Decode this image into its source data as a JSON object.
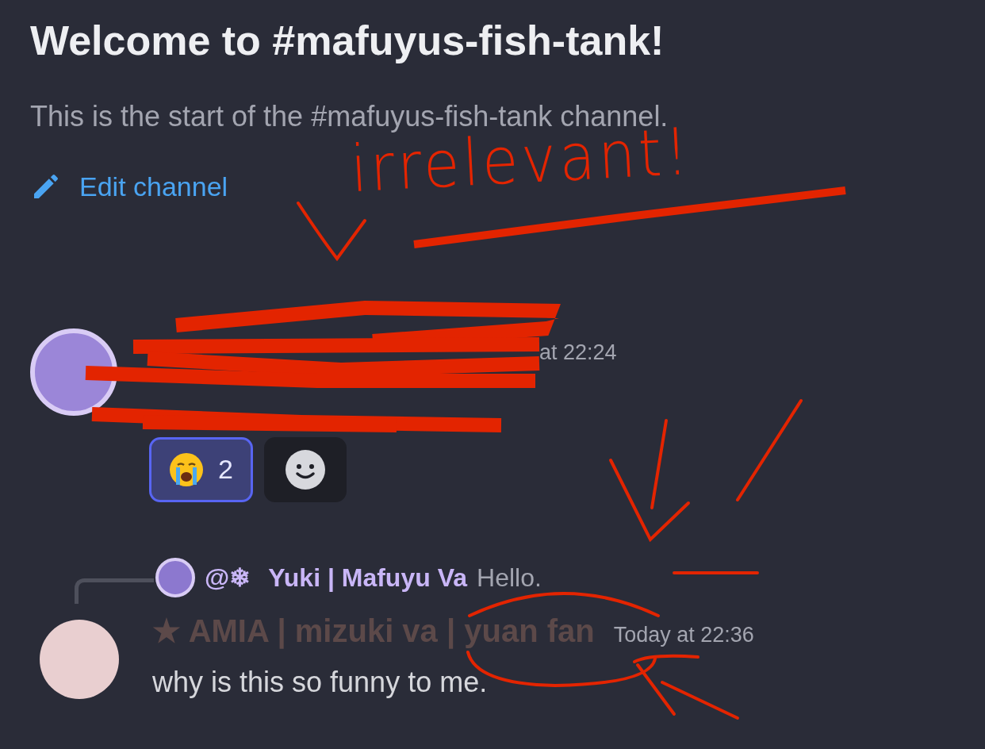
{
  "channel_intro": {
    "title": "Welcome to #mafuyus-fish-tank!",
    "subtitle": "This is the start of the #mafuyus-fish-tank channel.",
    "edit_link": "Edit channel"
  },
  "messages": [
    {
      "kind": "message",
      "timestamp": "at 22:24",
      "reactions": [
        {
          "count": "2",
          "selected": true
        }
      ]
    },
    {
      "kind": "reply",
      "reply_to": {
        "mention": "@❄",
        "author": "Yuki | Mafuyu Va",
        "content": "Hello."
      },
      "author": "★ AMIA | mizuki va | yuan fan",
      "timestamp": "Today at 22:36",
      "content": "why is this so funny to me."
    }
  ],
  "annotation": {
    "text": "irrelevant!"
  }
}
